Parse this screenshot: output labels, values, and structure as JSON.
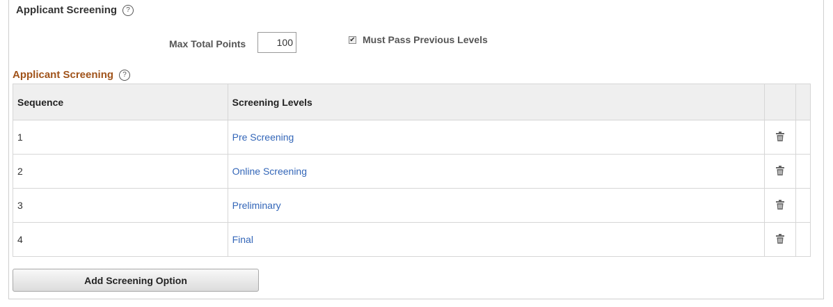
{
  "section": {
    "title": "Applicant Screening",
    "help_glyph": "?"
  },
  "max_points": {
    "label": "Max Total Points",
    "value": "100"
  },
  "must_pass": {
    "label": "Must Pass Previous Levels",
    "checked": true,
    "check_glyph": "✔"
  },
  "grid": {
    "title": "Applicant Screening",
    "help_glyph": "?",
    "columns": [
      "Sequence",
      "Screening Levels"
    ],
    "rows": [
      {
        "sequence": "1",
        "level": "Pre Screening"
      },
      {
        "sequence": "2",
        "level": "Online Screening"
      },
      {
        "sequence": "3",
        "level": "Preliminary"
      },
      {
        "sequence": "4",
        "level": "Final"
      }
    ],
    "row_action_icon": "trash-icon"
  },
  "add_button": {
    "label": "Add Screening Option"
  },
  "colors": {
    "grid_title": "#a0531a",
    "link": "#3366b8",
    "header_bg": "#efefef"
  }
}
